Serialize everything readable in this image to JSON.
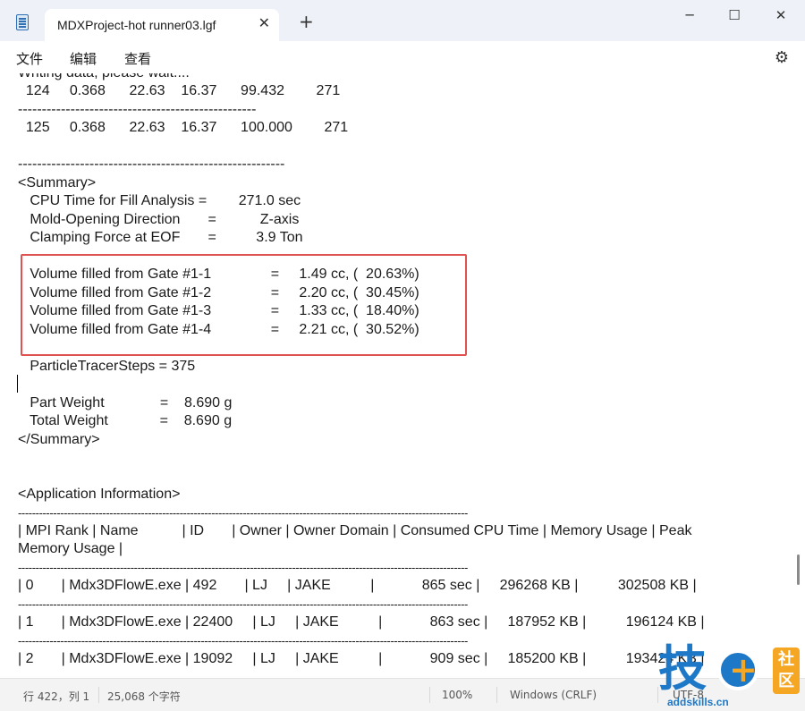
{
  "window": {
    "tab_title": "MDXProject-hot runner03.lgf",
    "tab_close_glyph": "✕",
    "new_tab_glyph": "+",
    "minimize_glyph": "─",
    "maximize_glyph": "☐",
    "close_glyph": "✕"
  },
  "menu": {
    "items": [
      "文件",
      "编辑",
      "查看"
    ],
    "settings_glyph": "⚙"
  },
  "editor": {
    "lines": [
      "Writing data, please wait....",
      "  124     0.368      22.63    16.37      99.432        271",
      "--------------------------------------------------",
      "  125     0.368      22.63    16.37      100.000        271",
      "",
      "--------------------------------------------------------",
      "<Summary>",
      "   CPU Time for Fill Analysis =        271.0 sec",
      "   Mold-Opening Direction       =           Z-axis",
      "   Clamping Force at EOF       =          3.9 Ton",
      "",
      "   Volume filled from Gate #1-1               =     1.49 cc, (  20.63%)",
      "   Volume filled from Gate #1-2               =     2.20 cc, (  30.45%)",
      "   Volume filled from Gate #1-3               =     1.33 cc, (  18.40%)",
      "   Volume filled from Gate #1-4               =     2.21 cc, (  30.52%)",
      "",
      "   ParticleTracerSteps = 375",
      "",
      "   Part Weight              =    8.690 g",
      "   Total Weight             =    8.690 g",
      "</Summary>",
      "",
      "",
      "<Application Information>",
      "--------------------------------------------------------------------------------------------------------------------------------",
      "| MPI Rank | Name           | ID       | Owner | Owner Domain | Consumed CPU Time | Memory Usage | Peak",
      "Memory Usage |",
      "--------------------------------------------------------------------------------------------------------------------------------",
      "| 0       | Mdx3DFlowE.exe | 492       | LJ     | JAKE          |            865 sec |     296268 KB |          302508 KB |",
      "--------------------------------------------------------------------------------------------------------------------------------",
      "| 1       | Mdx3DFlowE.exe | 22400     | LJ     | JAKE          |            863 sec |     187952 KB |          196124 KB |",
      "--------------------------------------------------------------------------------------------------------------------------------",
      "| 2       | Mdx3DFlowE.exe | 19092     | LJ     | JAKE          |            909 sec |     185200 KB |          193424 KB |"
    ]
  },
  "status": {
    "position": "行 422，列 1",
    "char_count": "25,068 个字符",
    "zoom": "100%",
    "line_ending": "Windows (CRLF)",
    "encoding": "UTF-8"
  },
  "watermark": {
    "char": "技",
    "plus": "+",
    "badge": "社区",
    "url": "addskills.cn"
  },
  "colors": {
    "highlight_border": "#e05252",
    "watermark_blue": "#1e78c8",
    "watermark_orange": "#f5a623"
  }
}
